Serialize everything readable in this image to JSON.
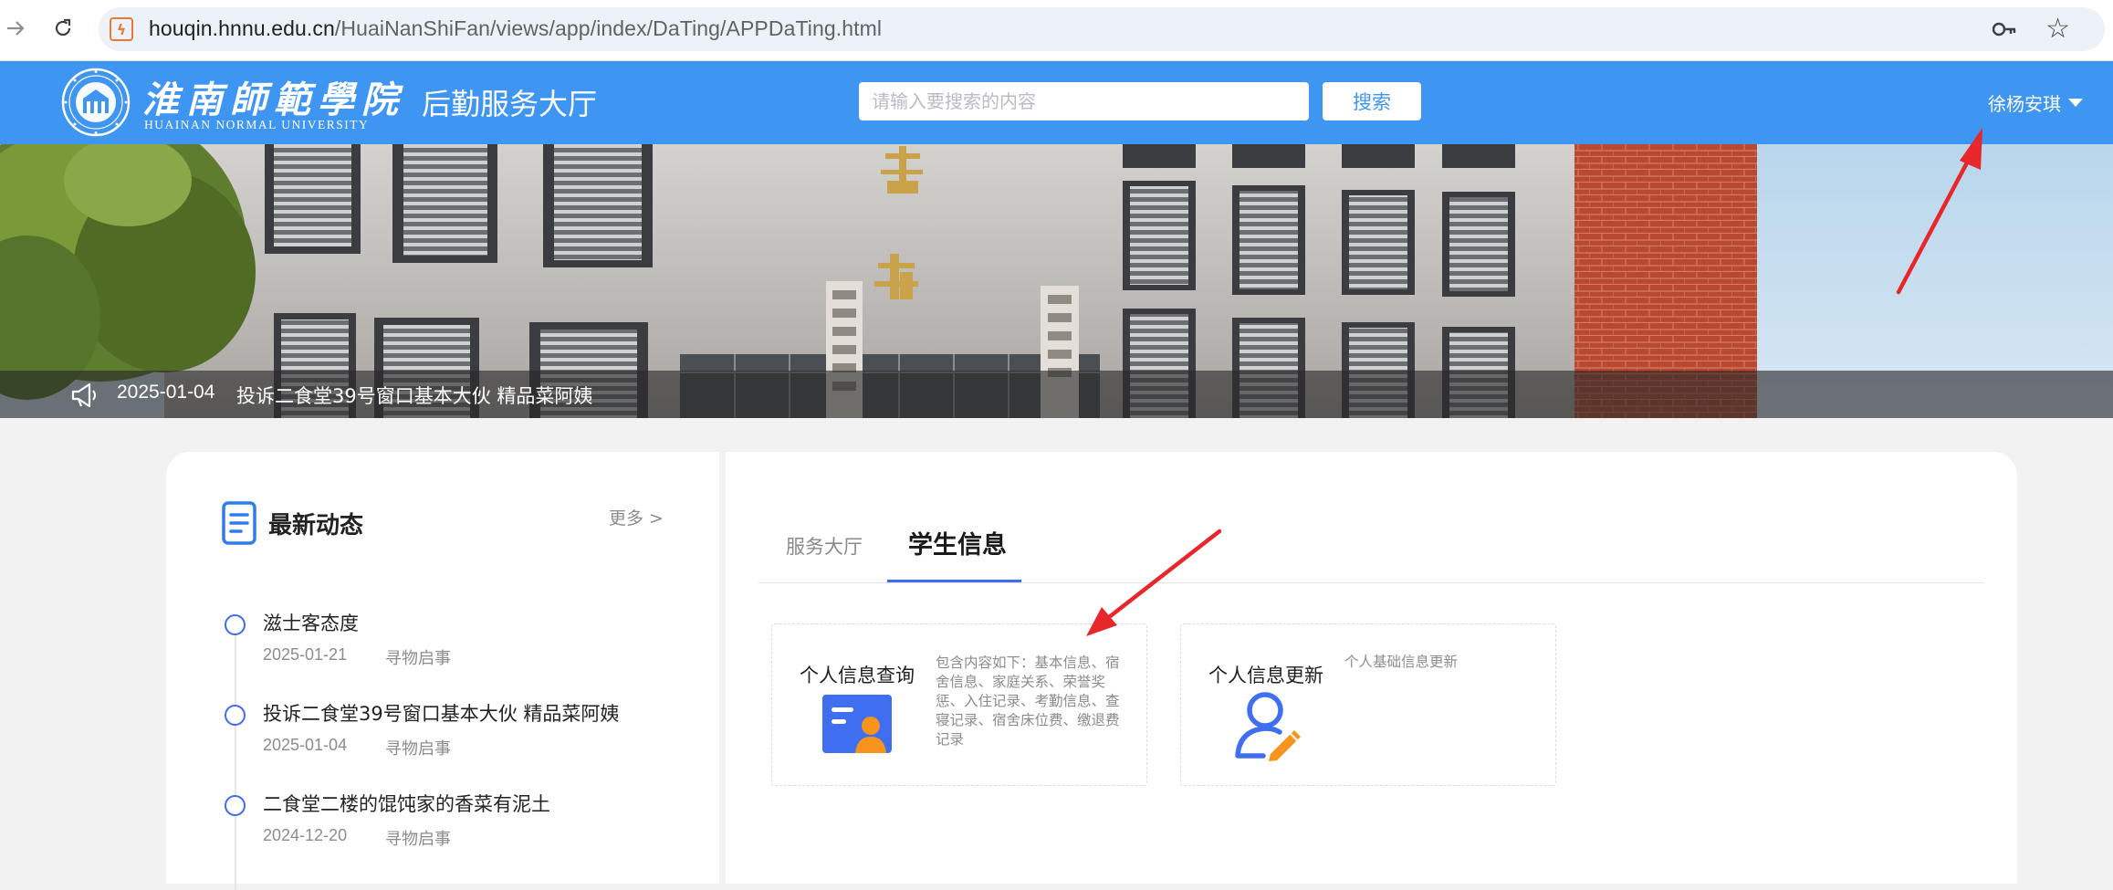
{
  "browser": {
    "url_host": "houqin.hnnu.edu.cn",
    "url_path": "/HuaiNanShiFan/views/app/index/DaTing/APPDaTing.html"
  },
  "header": {
    "logo_cn": "淮南師範學院",
    "logo_en": "HUAINAN NORMAL UNIVERSITY",
    "portal_title": "后勤服务大厅",
    "search_placeholder": "请输入要搜索的内容",
    "search_button": "搜索",
    "user_name": "徐杨安琪"
  },
  "banner": {
    "notice_date": "2025-01-04",
    "notice_title": "投诉二食堂39号窗口基本大伙 精品菜阿姨"
  },
  "news": {
    "heading": "最新动态",
    "more": "更多 >",
    "items": [
      {
        "title": "滋士客态度",
        "date": "2025-01-21",
        "category": "寻物启事"
      },
      {
        "title": "投诉二食堂39号窗口基本大伙 精品菜阿姨",
        "date": "2025-01-04",
        "category": "寻物启事"
      },
      {
        "title": "二食堂二楼的馄饨家的香菜有泥土",
        "date": "2024-12-20",
        "category": "寻物启事"
      }
    ]
  },
  "tabs": {
    "items": [
      {
        "label": "服务大厅",
        "active": false
      },
      {
        "label": "学生信息",
        "active": true
      }
    ]
  },
  "cards": [
    {
      "title": "个人信息查询",
      "description": "包含内容如下：基本信息、宿舍信息、家庭关系、荣誉奖惩、入住记录、考勤信息、查寝记录、宿舍床位费、缴退费记录",
      "icon": "id-card-icon"
    },
    {
      "title": "个人信息更新",
      "description": "个人基础信息更新",
      "icon": "user-edit-icon"
    }
  ],
  "colors": {
    "header_blue": "#3e95f2",
    "accent_blue": "#3e6bf0",
    "annotation_red": "#e8272a",
    "icon_orange": "#f7941d"
  }
}
